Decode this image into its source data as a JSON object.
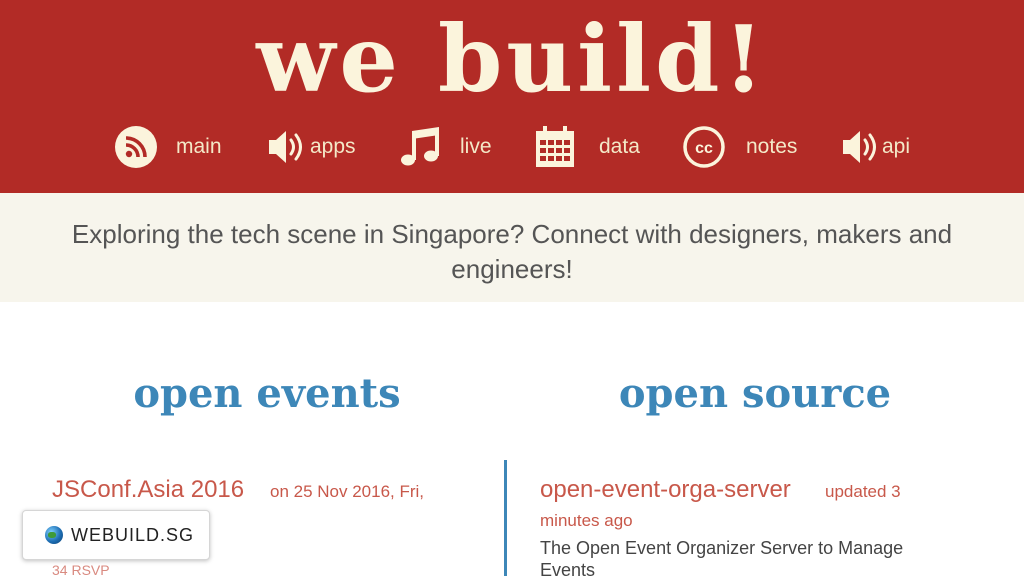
{
  "header": {
    "logo": "we build!",
    "nav": [
      {
        "label": "main",
        "icon": "rss-icon"
      },
      {
        "label": "apps",
        "icon": "speaker-icon"
      },
      {
        "label": "live",
        "icon": "music-note-icon"
      },
      {
        "label": "data",
        "icon": "calendar-icon"
      },
      {
        "label": "notes",
        "icon": "cc-icon"
      },
      {
        "label": "api",
        "icon": "speaker-icon"
      }
    ]
  },
  "tagline": "Exploring the tech scene in Singapore? Connect with designers, makers and engineers!",
  "events": {
    "title": "open events",
    "items": [
      {
        "name": "JSConf.Asia 2016",
        "date": "on 25 Nov 2016, Fri,",
        "rsvp": "34 RSVP"
      }
    ]
  },
  "opensource": {
    "title": "open source",
    "items": [
      {
        "name": "open-event-orga-server",
        "updated_a": "updated 3",
        "updated_b": "minutes ago",
        "description": "The Open Event Organizer Server to Manage Events"
      }
    ]
  },
  "badge": {
    "text": "WEBUILD.SG"
  },
  "colors": {
    "header": "#b22b26",
    "accent": "#3d87b8",
    "link": "#c8584a",
    "cream": "#fbf4dc"
  }
}
